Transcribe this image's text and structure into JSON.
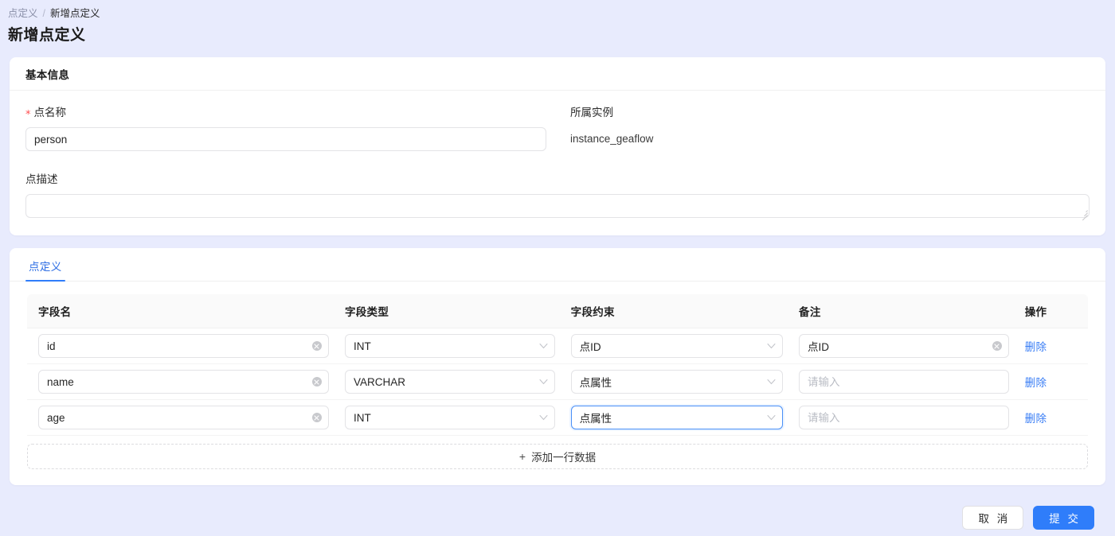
{
  "breadcrumb": {
    "parent": "点定义",
    "separator": "/",
    "current": "新增点定义"
  },
  "page_title": "新增点定义",
  "basic_info": {
    "section_title": "基本信息",
    "point_name": {
      "label": "点名称",
      "required_mark": "*",
      "value": "person",
      "placeholder": "请输入"
    },
    "instance": {
      "label": "所属实例",
      "value": "instance_geaflow"
    },
    "description": {
      "label": "点描述",
      "value": "",
      "placeholder": ""
    }
  },
  "definition": {
    "tabs": [
      {
        "label": "点定义",
        "active": true
      }
    ],
    "columns": [
      "字段名",
      "字段类型",
      "字段约束",
      "备注",
      "操作"
    ],
    "rows": [
      {
        "field_name": "id",
        "field_type": "INT",
        "constraint": "点ID",
        "remark": "点ID",
        "remark_placeholder": "请输入",
        "action": "删除",
        "name_has_clear": true,
        "remark_has_clear": true,
        "constraint_focused": false
      },
      {
        "field_name": "name",
        "field_type": "VARCHAR",
        "constraint": "点属性",
        "remark": "",
        "remark_placeholder": "请输入",
        "action": "删除",
        "name_has_clear": true,
        "remark_has_clear": false,
        "constraint_focused": false
      },
      {
        "field_name": "age",
        "field_type": "INT",
        "constraint": "点属性",
        "remark": "",
        "remark_placeholder": "请输入",
        "action": "删除",
        "name_has_clear": true,
        "remark_has_clear": false,
        "constraint_focused": true
      }
    ],
    "add_row_label": "添加一行数据",
    "add_row_icon": "plus-icon"
  },
  "footer": {
    "cancel_label": "取 消",
    "submit_label": "提 交"
  },
  "colors": {
    "page_background": "#e8ebfd",
    "accent_blue": "#2f7dfa",
    "link_blue": "#3a7ef5",
    "required_red": "#ff4d4f",
    "card_white": "#ffffff",
    "table_header_gray": "#fafafa"
  }
}
